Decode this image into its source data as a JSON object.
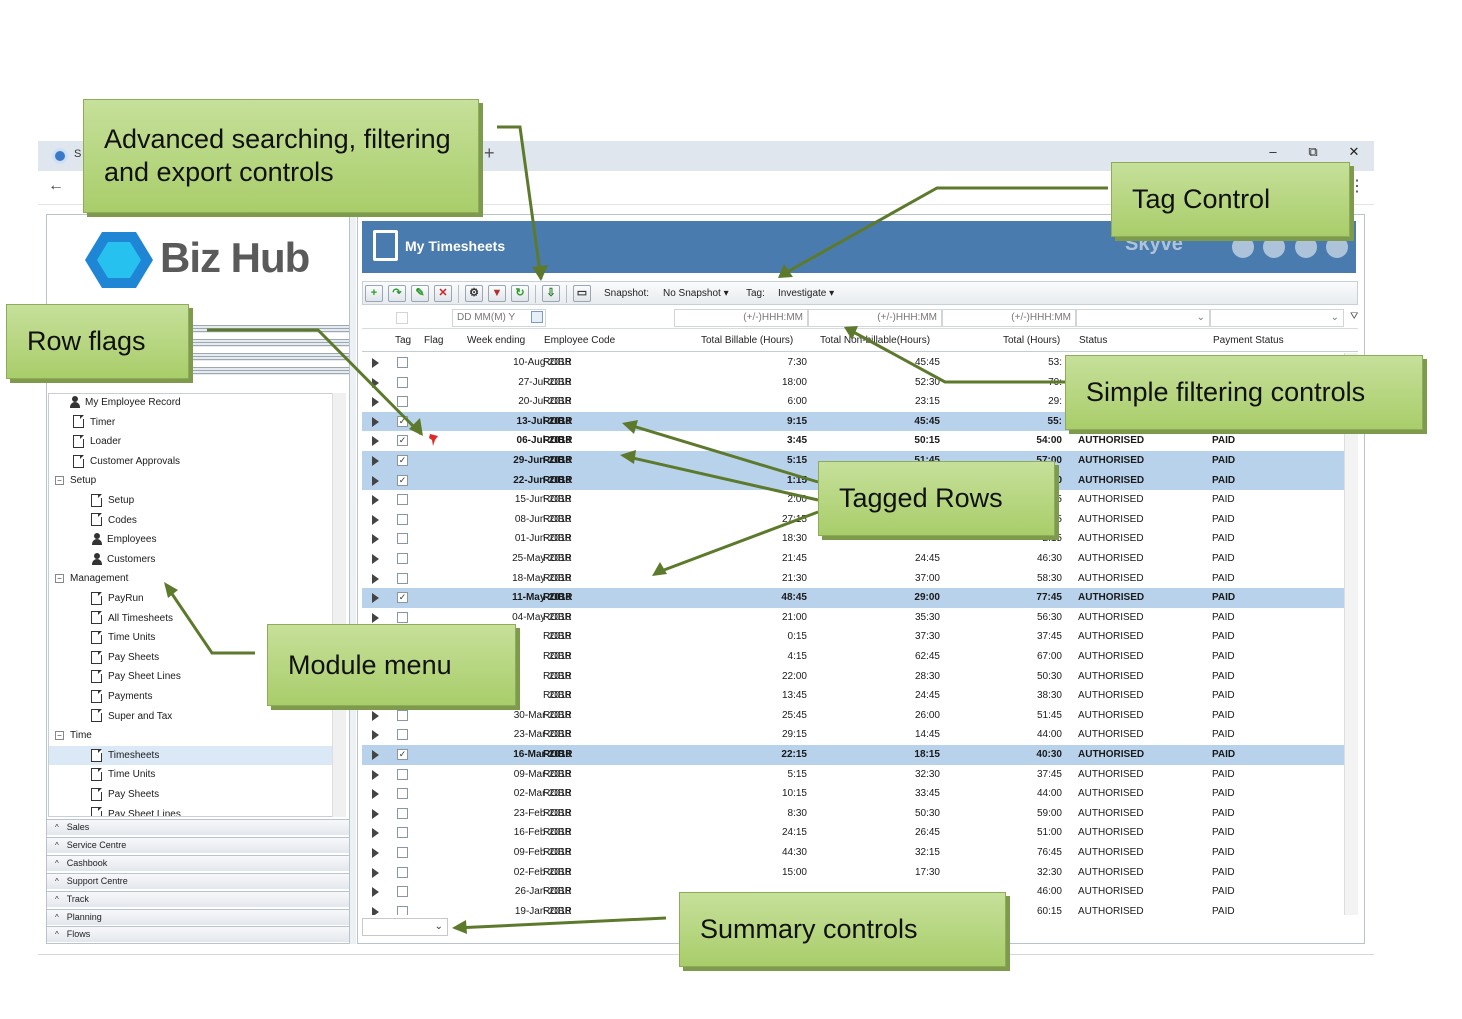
{
  "browser": {
    "tab_fragment": "S",
    "new_tab": "+",
    "minimize": "–",
    "restore": "⧉",
    "close": "✕",
    "back": "←",
    "menu": "⋮"
  },
  "logo": {
    "text": "Biz Hub",
    "colors": [
      "#1f86d6",
      "#27c1f0",
      "#0e64b4"
    ]
  },
  "tree": [
    {
      "label": "My Employee Record",
      "icon": "person-icon",
      "indent": 1
    },
    {
      "label": "Timer",
      "icon": "doc-icon",
      "indent": 2
    },
    {
      "label": "Loader",
      "icon": "doc-icon",
      "indent": 2
    },
    {
      "label": "Customer Approvals",
      "icon": "doc-icon",
      "indent": 2
    },
    {
      "label": "Setup",
      "icon": "expander",
      "indent": 0
    },
    {
      "label": "Setup",
      "icon": "doc-icon",
      "indent": 3
    },
    {
      "label": "Codes",
      "icon": "doc-icon",
      "indent": 3
    },
    {
      "label": "Employees",
      "icon": "person-icon",
      "indent": 3
    },
    {
      "label": "Customers",
      "icon": "person-icon",
      "indent": 3
    },
    {
      "label": "Management",
      "icon": "expander",
      "indent": 0
    },
    {
      "label": "PayRun",
      "icon": "doc-icon",
      "indent": 3
    },
    {
      "label": "All Timesheets",
      "icon": "doc-icon",
      "indent": 3
    },
    {
      "label": "Time Units",
      "icon": "doc-icon",
      "indent": 3
    },
    {
      "label": "Pay Sheets",
      "icon": "doc-icon",
      "indent": 3
    },
    {
      "label": "Pay Sheet Lines",
      "icon": "doc-icon",
      "indent": 3
    },
    {
      "label": "Payments",
      "icon": "doc-icon",
      "indent": 3
    },
    {
      "label": "Super and Tax",
      "icon": "doc-icon",
      "indent": 3
    },
    {
      "label": "Time",
      "icon": "expander",
      "indent": 0
    },
    {
      "label": "Timesheets",
      "icon": "doc-icon",
      "indent": 3,
      "selected": true
    },
    {
      "label": "Time Units",
      "icon": "doc-icon",
      "indent": 3
    },
    {
      "label": "Pay Sheets",
      "icon": "doc-icon",
      "indent": 3
    },
    {
      "label": "Pay Sheet Lines",
      "icon": "doc-icon",
      "indent": 3
    }
  ],
  "sections": [
    "Sales",
    "Service Centre",
    "Cashbook",
    "Support Centre",
    "Track",
    "Planning",
    "Flows"
  ],
  "main": {
    "title": "My Timesheets",
    "brand": "Skyve",
    "toolbar": {
      "snapshot_label": "Snapshot:",
      "snapshot_value": "No Snapshot",
      "tag_label": "Tag:",
      "tag_value": "Investigate"
    },
    "filters": {
      "date": "DD MM(M) Y",
      "billable": "(+/-)HHH:MM",
      "nonbillable": "(+/-)HHH:MM",
      "total": "(+/-)HHH:MM"
    },
    "columns": {
      "tag": "Tag",
      "flag": "Flag",
      "week": "Week ending",
      "emp": "Employee Code",
      "billable": "Total Billable (Hours)",
      "nonbillable": "Total Non-billable(Hours)",
      "total": "Total (Hours)",
      "status": "Status",
      "pay": "Payment Status"
    }
  },
  "rows": [
    {
      "week": "10-Aug-2018",
      "emp": "ROBR",
      "bill": "7:30",
      "non": "45:45",
      "total": "53:",
      "status": "",
      "pay": "",
      "tag": false
    },
    {
      "week": "27-Jul-2018",
      "emp": "ROBR",
      "bill": "18:00",
      "non": "52:30",
      "total": "70:",
      "status": "",
      "pay": "",
      "tag": false
    },
    {
      "week": "20-Jul-2018",
      "emp": "ROBR",
      "bill": "6:00",
      "non": "23:15",
      "total": "29:",
      "status": "",
      "pay": "",
      "tag": false
    },
    {
      "week": "13-Jul-2018",
      "emp": "ROBR",
      "bill": "9:15",
      "non": "45:45",
      "total": "55:",
      "status": "",
      "pay": "",
      "tag": true
    },
    {
      "week": "06-Jul-2018",
      "emp": "ROBR",
      "bill": "3:45",
      "non": "50:15",
      "total": "54:00",
      "status": "AUTHORISED",
      "pay": "PAID",
      "tag": false,
      "checked": true,
      "bold": true,
      "flag": true
    },
    {
      "week": "29-Jun-2018",
      "emp": "ROBR",
      "bill": "5:15",
      "non": "51:45",
      "total": "57:00",
      "status": "AUTHORISED",
      "pay": "PAID",
      "tag": true
    },
    {
      "week": "22-Jun-2018",
      "emp": "ROBR",
      "bill": "1:15",
      "non": "",
      "total": "6:00",
      "status": "AUTHORISED",
      "pay": "PAID",
      "tag": true
    },
    {
      "week": "15-Jun-2018",
      "emp": "ROBR",
      "bill": "2:00",
      "non": "",
      "total": "4:15",
      "status": "AUTHORISED",
      "pay": "PAID",
      "tag": false
    },
    {
      "week": "08-Jun-2018",
      "emp": "ROBR",
      "bill": "27:15",
      "non": "",
      "total": "4:15",
      "status": "AUTHORISED",
      "pay": "PAID",
      "tag": false
    },
    {
      "week": "01-Jun-2018",
      "emp": "ROBR",
      "bill": "18:30",
      "non": "",
      "total": "2:15",
      "status": "AUTHORISED",
      "pay": "PAID",
      "tag": false
    },
    {
      "week": "25-May-2018",
      "emp": "ROBR",
      "bill": "21:45",
      "non": "24:45",
      "total": "46:30",
      "status": "AUTHORISED",
      "pay": "PAID",
      "tag": false
    },
    {
      "week": "18-May-2018",
      "emp": "ROBR",
      "bill": "21:30",
      "non": "37:00",
      "total": "58:30",
      "status": "AUTHORISED",
      "pay": "PAID",
      "tag": false
    },
    {
      "week": "11-May-2018",
      "emp": "ROBR",
      "bill": "48:45",
      "non": "29:00",
      "total": "77:45",
      "status": "AUTHORISED",
      "pay": "PAID",
      "tag": true
    },
    {
      "week": "04-May-2018",
      "emp": "ROBR",
      "bill": "21:00",
      "non": "35:30",
      "total": "56:30",
      "status": "AUTHORISED",
      "pay": "PAID",
      "tag": false
    },
    {
      "week": "2018",
      "emp": "ROBR",
      "bill": "0:15",
      "non": "37:30",
      "total": "37:45",
      "status": "AUTHORISED",
      "pay": "PAID",
      "tag": false
    },
    {
      "week": "2018",
      "emp": "ROBR",
      "bill": "4:15",
      "non": "62:45",
      "total": "67:00",
      "status": "AUTHORISED",
      "pay": "PAID",
      "tag": false
    },
    {
      "week": "2018",
      "emp": "ROBR",
      "bill": "22:00",
      "non": "28:30",
      "total": "50:30",
      "status": "AUTHORISED",
      "pay": "PAID",
      "tag": false
    },
    {
      "week": "2018",
      "emp": "ROBR",
      "bill": "13:45",
      "non": "24:45",
      "total": "38:30",
      "status": "AUTHORISED",
      "pay": "PAID",
      "tag": false
    },
    {
      "week": "30-Mar-2018",
      "emp": "ROBR",
      "bill": "25:45",
      "non": "26:00",
      "total": "51:45",
      "status": "AUTHORISED",
      "pay": "PAID",
      "tag": false
    },
    {
      "week": "23-Mar-2018",
      "emp": "ROBR",
      "bill": "29:15",
      "non": "14:45",
      "total": "44:00",
      "status": "AUTHORISED",
      "pay": "PAID",
      "tag": false
    },
    {
      "week": "16-Mar-2018",
      "emp": "ROBR",
      "bill": "22:15",
      "non": "18:15",
      "total": "40:30",
      "status": "AUTHORISED",
      "pay": "PAID",
      "tag": true
    },
    {
      "week": "09-Mar-2018",
      "emp": "ROBR",
      "bill": "5:15",
      "non": "32:30",
      "total": "37:45",
      "status": "AUTHORISED",
      "pay": "PAID",
      "tag": false
    },
    {
      "week": "02-Mar-2018",
      "emp": "ROBR",
      "bill": "10:15",
      "non": "33:45",
      "total": "44:00",
      "status": "AUTHORISED",
      "pay": "PAID",
      "tag": false
    },
    {
      "week": "23-Feb-2018",
      "emp": "ROBR",
      "bill": "8:30",
      "non": "50:30",
      "total": "59:00",
      "status": "AUTHORISED",
      "pay": "PAID",
      "tag": false
    },
    {
      "week": "16-Feb-2018",
      "emp": "ROBR",
      "bill": "24:15",
      "non": "26:45",
      "total": "51:00",
      "status": "AUTHORISED",
      "pay": "PAID",
      "tag": false
    },
    {
      "week": "09-Feb-2018",
      "emp": "ROBR",
      "bill": "44:30",
      "non": "32:15",
      "total": "76:45",
      "status": "AUTHORISED",
      "pay": "PAID",
      "tag": false
    },
    {
      "week": "02-Feb-2018",
      "emp": "ROBR",
      "bill": "15:00",
      "non": "17:30",
      "total": "32:30",
      "status": "AUTHORISED",
      "pay": "PAID",
      "tag": false
    },
    {
      "week": "26-Jan-2018",
      "emp": "ROBR",
      "bill": "",
      "non": "",
      "total": "46:00",
      "status": "AUTHORISED",
      "pay": "PAID",
      "tag": false
    },
    {
      "week": "19-Jan-2018",
      "emp": "ROBR",
      "bill": "",
      "non": "",
      "total": "60:15",
      "status": "AUTHORISED",
      "pay": "PAID",
      "tag": false
    }
  ],
  "callouts": {
    "advanced": "Advanced searching, filtering and export controls",
    "tag_control": "Tag Control",
    "row_flags": "Row flags",
    "simple_filter": "Simple filtering controls",
    "tagged_rows": "Tagged Rows",
    "module_menu": "Module menu",
    "summary": "Summary controls"
  },
  "colors": {
    "header": "#4a7bae",
    "tagged_row": "#b8d2ec",
    "callout": "#b5d57e",
    "arrow": "#5d7a2c"
  }
}
